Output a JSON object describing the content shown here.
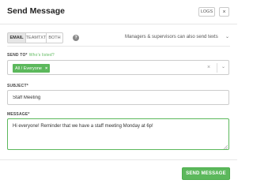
{
  "header": {
    "title": "Send Message",
    "logs_label": "LOGS",
    "close_glyph": "×"
  },
  "tabs": [
    {
      "label": "EMAIL",
      "active": true
    },
    {
      "label": "TEAMTXT",
      "active": false
    },
    {
      "label": "BOTH",
      "active": false
    }
  ],
  "help_glyph": "?",
  "permission_note": "Managers & supervisors can also send texts",
  "permission_chevron": "⌄",
  "send_to": {
    "label": "SEND TO*",
    "who_link": "Who's listed?",
    "selected": [
      {
        "label": "All / Everyone",
        "remove_glyph": "×"
      }
    ],
    "clear_glyph": "×",
    "chevron_glyph": "⌄"
  },
  "subject": {
    "label": "SUBJECT*",
    "value": "Staff Meeting"
  },
  "message": {
    "label": "MESSAGE*",
    "value": "Hi everyone! Reminder that we have a staff meeting Monday at 6p!"
  },
  "send_button": "SEND MESSAGE",
  "colors": {
    "accent": "#5cb85c",
    "border": "#cccccc",
    "active_tab": "#e6e6e6"
  },
  "icons": {
    "help": "help-icon",
    "close": "close-icon",
    "dropdown": "chevron-down-icon",
    "clear": "clear-icon",
    "resize": "resize-grip-icon"
  }
}
